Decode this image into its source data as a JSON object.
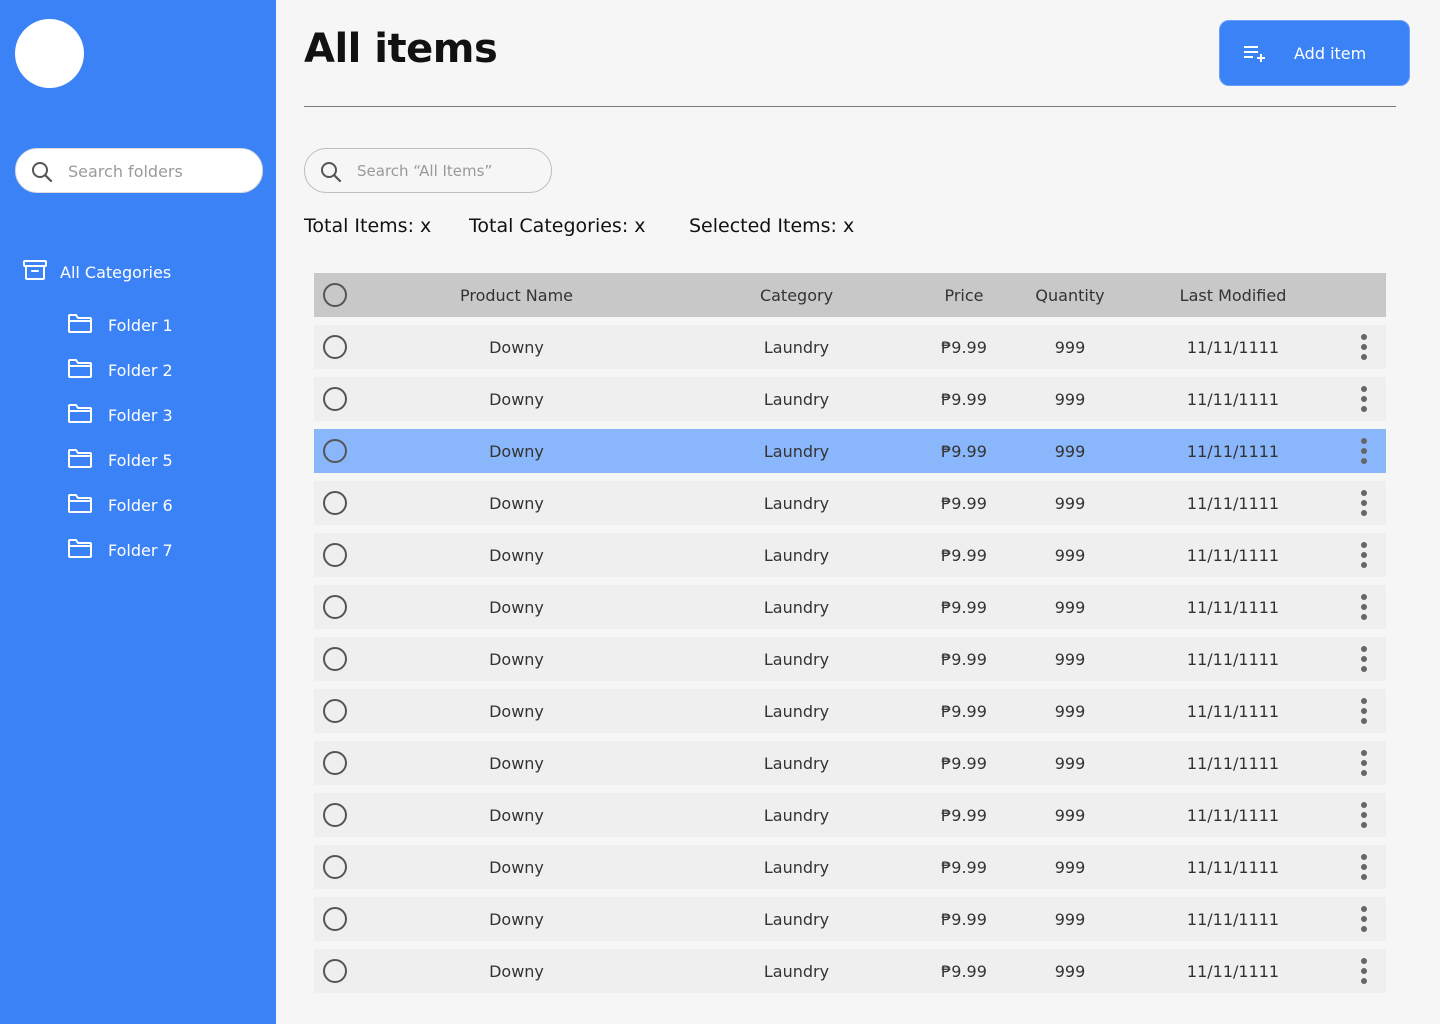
{
  "sidebar": {
    "search_placeholder": "Search folders",
    "all_categories_label": "All Categories",
    "folders": [
      {
        "label": "Folder 1"
      },
      {
        "label": "Folder 2"
      },
      {
        "label": "Folder 3"
      },
      {
        "label": "Folder 5"
      },
      {
        "label": "Folder 6"
      },
      {
        "label": "Folder 7"
      }
    ],
    "bg_color": "#3b82f6"
  },
  "header": {
    "title": "All items",
    "add_button_label": "Add item"
  },
  "items_search": {
    "placeholder": "Search “All Items”"
  },
  "stats": {
    "total_items": "Total Items: x",
    "total_categories": "Total Categories: x",
    "selected_items": "Selected Items: x"
  },
  "table": {
    "columns": {
      "product_name": "Product Name",
      "category": "Category",
      "price": "Price",
      "quantity": "Quantity",
      "last_modified": "Last Modified"
    },
    "selected_row_color": "#8ab6fb",
    "rows": [
      {
        "name": "Downy",
        "category": "Laundry",
        "price": "₱9.99",
        "quantity": "999",
        "date": "11/11/1111",
        "selected": false
      },
      {
        "name": "Downy",
        "category": "Laundry",
        "price": "₱9.99",
        "quantity": "999",
        "date": "11/11/1111",
        "selected": false
      },
      {
        "name": "Downy",
        "category": "Laundry",
        "price": "₱9.99",
        "quantity": "999",
        "date": "11/11/1111",
        "selected": true
      },
      {
        "name": "Downy",
        "category": "Laundry",
        "price": "₱9.99",
        "quantity": "999",
        "date": "11/11/1111",
        "selected": false
      },
      {
        "name": "Downy",
        "category": "Laundry",
        "price": "₱9.99",
        "quantity": "999",
        "date": "11/11/1111",
        "selected": false
      },
      {
        "name": "Downy",
        "category": "Laundry",
        "price": "₱9.99",
        "quantity": "999",
        "date": "11/11/1111",
        "selected": false
      },
      {
        "name": "Downy",
        "category": "Laundry",
        "price": "₱9.99",
        "quantity": "999",
        "date": "11/11/1111",
        "selected": false
      },
      {
        "name": "Downy",
        "category": "Laundry",
        "price": "₱9.99",
        "quantity": "999",
        "date": "11/11/1111",
        "selected": false
      },
      {
        "name": "Downy",
        "category": "Laundry",
        "price": "₱9.99",
        "quantity": "999",
        "date": "11/11/1111",
        "selected": false
      },
      {
        "name": "Downy",
        "category": "Laundry",
        "price": "₱9.99",
        "quantity": "999",
        "date": "11/11/1111",
        "selected": false
      },
      {
        "name": "Downy",
        "category": "Laundry",
        "price": "₱9.99",
        "quantity": "999",
        "date": "11/11/1111",
        "selected": false
      },
      {
        "name": "Downy",
        "category": "Laundry",
        "price": "₱9.99",
        "quantity": "999",
        "date": "11/11/1111",
        "selected": false
      },
      {
        "name": "Downy",
        "category": "Laundry",
        "price": "₱9.99",
        "quantity": "999",
        "date": "11/11/1111",
        "selected": false
      }
    ]
  }
}
